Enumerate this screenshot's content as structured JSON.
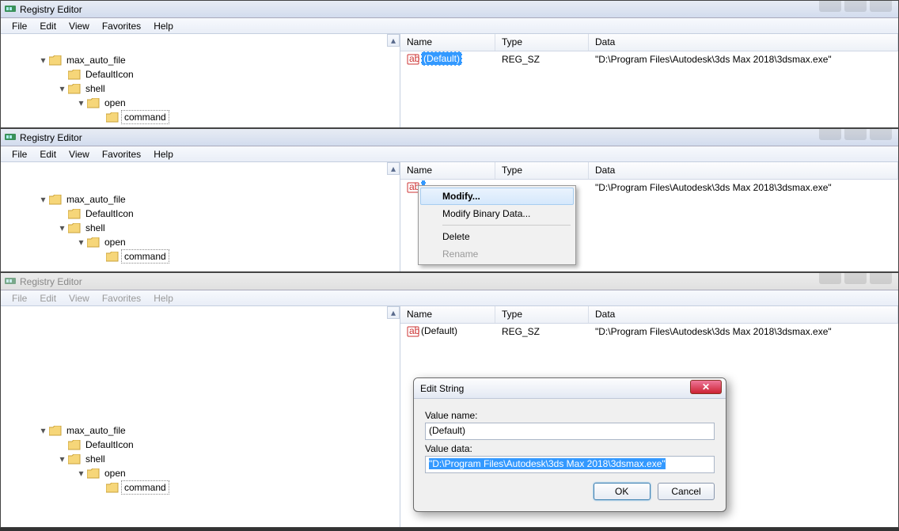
{
  "title": "Registry Editor",
  "menu": [
    "File",
    "Edit",
    "View",
    "Favorites",
    "Help"
  ],
  "tree": [
    {
      "indent": 44,
      "exp": "▾",
      "name": "max_auto_file",
      "color": "#f6d679"
    },
    {
      "indent": 68,
      "exp": " ",
      "name": "DefaultIcon",
      "color": "#f6d679"
    },
    {
      "indent": 68,
      "exp": "▾",
      "name": "shell",
      "color": "#f6d679"
    },
    {
      "indent": 92,
      "exp": "▾",
      "name": "open",
      "color": "#f6d679"
    },
    {
      "indent": 116,
      "exp": " ",
      "name": "command",
      "color": "#f6d679",
      "selected": true
    }
  ],
  "list": {
    "cols": {
      "name": "Name",
      "type": "Type",
      "data": "Data"
    },
    "row": {
      "name": "(Default)",
      "type": "REG_SZ",
      "data": "\"D:\\Program Files\\Autodesk\\3ds Max 2018\\3dsmax.exe\""
    }
  },
  "ctx": {
    "modify": "Modify...",
    "modbin": "Modify Binary Data...",
    "delete": "Delete",
    "rename": "Rename"
  },
  "dialog": {
    "title": "Edit String",
    "vn_label": "Value name:",
    "vn_value": "(Default)",
    "vd_label": "Value data:",
    "vd_value": "\"D:\\Program Files\\Autodesk\\3ds Max 2018\\3dsmax.exe\"",
    "ok": "OK",
    "cancel": "Cancel"
  }
}
